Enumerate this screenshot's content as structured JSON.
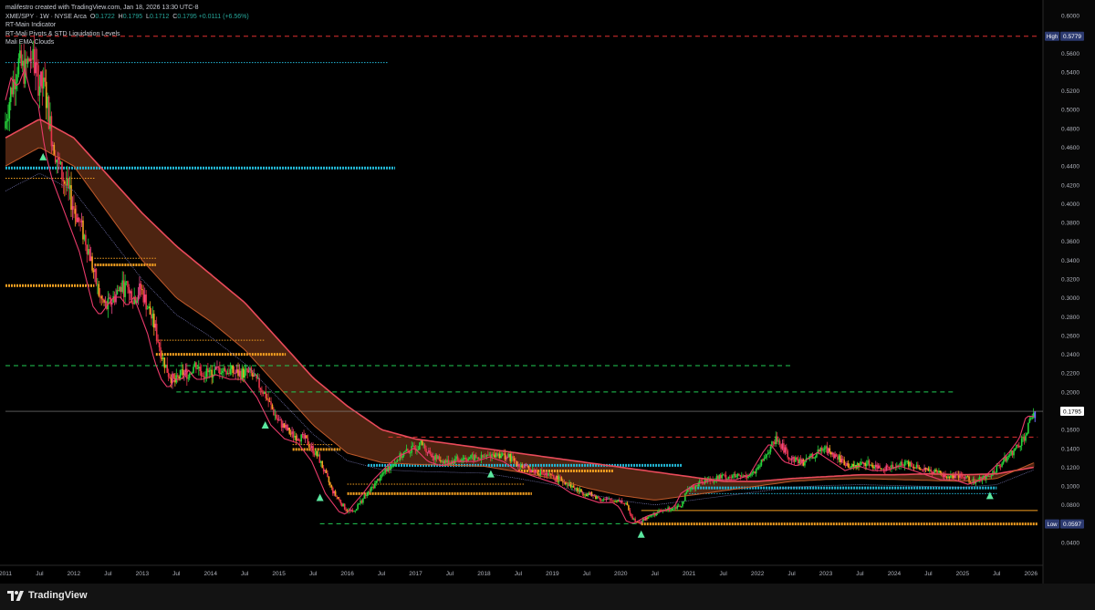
{
  "header": {
    "credit": "malifestro created with TradingView.com, Jan 18, 2026 13:30 UTC-8",
    "symbol": "XME/SPY · 1W · NYSE Arca",
    "ohlc": [
      {
        "k": "O",
        "v": "0.1722"
      },
      {
        "k": "H",
        "v": "0.1795"
      },
      {
        "k": "L",
        "v": "0.1712"
      },
      {
        "k": "C",
        "v": "0.1795"
      }
    ],
    "change": "+0.0111 (+6.56%)",
    "indicators": [
      "RT-Main Indicator",
      "RT-Mali Pivots & STD Liquidation Levels",
      "Mali EMA Clouds"
    ]
  },
  "footer": {
    "brand": "TradingView"
  },
  "colors": {
    "background": "#000000",
    "bull": "#26d43b",
    "bear": "#e8344a",
    "cloud_fill": "#5a2a14",
    "cloud_edge": "#e84a5a",
    "cyan_level": "#22b8d6",
    "orange_level": "#f5a020",
    "red_dash": "#e03030",
    "green_dash": "#22cc55"
  },
  "chart_data": {
    "type": "line",
    "x": [
      "2011",
      "Jul",
      "2012",
      "Jul",
      "2013",
      "Jul",
      "2014",
      "Jul",
      "2015",
      "Jul",
      "2016",
      "Jul",
      "2017",
      "Jul",
      "2018",
      "Jul",
      "2019",
      "Jul",
      "2020",
      "Jul",
      "2021",
      "Jul",
      "2022",
      "Jul",
      "2023",
      "Jul",
      "2024",
      "Jul",
      "2025",
      "Jul",
      "2026"
    ],
    "ylim": [
      0.02,
      0.6
    ],
    "y_ticks": [
      "0.6000",
      "0.5800",
      "0.5600",
      "0.5400",
      "0.5200",
      "0.5000",
      "0.4800",
      "0.4600",
      "0.4400",
      "0.4200",
      "0.4000",
      "0.3800",
      "0.3600",
      "0.3400",
      "0.3200",
      "0.3000",
      "0.2800",
      "0.2600",
      "0.2400",
      "0.2200",
      "0.2000",
      "0.1800",
      "0.1600",
      "0.1400",
      "0.1200",
      "0.1000",
      "0.0800",
      "0.0600",
      "0.0400"
    ],
    "price_label": "0.1795",
    "high": {
      "label": "High",
      "value": "0.5779"
    },
    "low": {
      "label": "Low",
      "value": "0.0597"
    },
    "series": [
      {
        "points": [
          [
            2011.0,
            0.48
          ],
          [
            2011.1,
            0.52
          ],
          [
            2011.2,
            0.55
          ],
          [
            2011.3,
            0.54
          ],
          [
            2011.4,
            0.56
          ],
          [
            2011.5,
            0.53
          ],
          [
            2011.6,
            0.52
          ],
          [
            2011.7,
            0.47
          ],
          [
            2011.8,
            0.44
          ],
          [
            2011.9,
            0.42
          ],
          [
            2012.0,
            0.4
          ],
          [
            2012.1,
            0.38
          ],
          [
            2012.2,
            0.36
          ],
          [
            2012.3,
            0.33
          ],
          [
            2012.4,
            0.3
          ],
          [
            2012.5,
            0.29
          ],
          [
            2012.6,
            0.3
          ],
          [
            2012.7,
            0.31
          ],
          [
            2012.8,
            0.31
          ],
          [
            2012.9,
            0.3
          ],
          [
            2013.0,
            0.31
          ],
          [
            2013.1,
            0.29
          ],
          [
            2013.2,
            0.27
          ],
          [
            2013.3,
            0.24
          ],
          [
            2013.4,
            0.22
          ],
          [
            2013.5,
            0.21
          ],
          [
            2013.6,
            0.22
          ],
          [
            2013.7,
            0.22
          ],
          [
            2013.8,
            0.23
          ],
          [
            2013.9,
            0.22
          ],
          [
            2014.0,
            0.22
          ],
          [
            2014.2,
            0.225
          ],
          [
            2014.4,
            0.22
          ],
          [
            2014.6,
            0.22
          ],
          [
            2014.8,
            0.2
          ],
          [
            2015.0,
            0.17
          ],
          [
            2015.2,
            0.155
          ],
          [
            2015.4,
            0.15
          ],
          [
            2015.6,
            0.13
          ],
          [
            2015.8,
            0.095
          ],
          [
            2016.0,
            0.075
          ],
          [
            2016.1,
            0.072
          ],
          [
            2016.2,
            0.082
          ],
          [
            2016.35,
            0.095
          ],
          [
            2016.5,
            0.11
          ],
          [
            2016.7,
            0.125
          ],
          [
            2016.85,
            0.135
          ],
          [
            2017.0,
            0.14
          ],
          [
            2017.1,
            0.145
          ],
          [
            2017.3,
            0.13
          ],
          [
            2017.5,
            0.125
          ],
          [
            2017.7,
            0.13
          ],
          [
            2017.9,
            0.13
          ],
          [
            2018.0,
            0.13
          ],
          [
            2018.2,
            0.135
          ],
          [
            2018.4,
            0.13
          ],
          [
            2018.6,
            0.12
          ],
          [
            2018.8,
            0.115
          ],
          [
            2019.0,
            0.11
          ],
          [
            2019.2,
            0.105
          ],
          [
            2019.4,
            0.095
          ],
          [
            2019.6,
            0.09
          ],
          [
            2019.8,
            0.085
          ],
          [
            2020.0,
            0.085
          ],
          [
            2020.1,
            0.08
          ],
          [
            2020.2,
            0.065
          ],
          [
            2020.3,
            0.062
          ],
          [
            2020.5,
            0.07
          ],
          [
            2020.7,
            0.075
          ],
          [
            2020.9,
            0.08
          ],
          [
            2021.0,
            0.095
          ],
          [
            2021.2,
            0.105
          ],
          [
            2021.5,
            0.11
          ],
          [
            2021.8,
            0.11
          ],
          [
            2022.0,
            0.115
          ],
          [
            2022.2,
            0.14
          ],
          [
            2022.3,
            0.15
          ],
          [
            2022.5,
            0.13
          ],
          [
            2022.7,
            0.125
          ],
          [
            2022.9,
            0.135
          ],
          [
            2023.0,
            0.14
          ],
          [
            2023.2,
            0.13
          ],
          [
            2023.4,
            0.12
          ],
          [
            2023.6,
            0.125
          ],
          [
            2023.8,
            0.12
          ],
          [
            2024.0,
            0.12
          ],
          [
            2024.2,
            0.125
          ],
          [
            2024.4,
            0.12
          ],
          [
            2024.6,
            0.115
          ],
          [
            2024.8,
            0.11
          ],
          [
            2025.0,
            0.11
          ],
          [
            2025.2,
            0.105
          ],
          [
            2025.4,
            0.11
          ],
          [
            2025.6,
            0.125
          ],
          [
            2025.8,
            0.14
          ],
          [
            2025.95,
            0.155
          ],
          [
            2026.05,
            0.1795
          ]
        ]
      },
      {
        "points": [
          [
            2011.0,
            0.47
          ],
          [
            2011.5,
            0.49
          ],
          [
            2012.0,
            0.47
          ],
          [
            2012.5,
            0.43
          ],
          [
            2013.0,
            0.39
          ],
          [
            2013.5,
            0.355
          ],
          [
            2014.0,
            0.325
          ],
          [
            2014.5,
            0.295
          ],
          [
            2015.0,
            0.255
          ],
          [
            2015.5,
            0.215
          ],
          [
            2016.0,
            0.185
          ],
          [
            2016.5,
            0.16
          ],
          [
            2017.0,
            0.15
          ],
          [
            2017.5,
            0.145
          ],
          [
            2018.0,
            0.14
          ],
          [
            2018.5,
            0.135
          ],
          [
            2019.0,
            0.13
          ],
          [
            2019.5,
            0.125
          ],
          [
            2020.0,
            0.12
          ],
          [
            2020.5,
            0.115
          ],
          [
            2021.0,
            0.11
          ],
          [
            2021.5,
            0.105
          ],
          [
            2022.0,
            0.105
          ],
          [
            2022.5,
            0.108
          ],
          [
            2023.0,
            0.11
          ],
          [
            2023.5,
            0.112
          ],
          [
            2024.0,
            0.112
          ],
          [
            2024.5,
            0.113
          ],
          [
            2025.0,
            0.112
          ],
          [
            2025.5,
            0.113
          ],
          [
            2026.05,
            0.12
          ]
        ]
      },
      {
        "points": [
          [
            2011.0,
            0.44
          ],
          [
            2011.5,
            0.46
          ],
          [
            2012.0,
            0.44
          ],
          [
            2012.5,
            0.39
          ],
          [
            2013.0,
            0.34
          ],
          [
            2013.5,
            0.3
          ],
          [
            2014.0,
            0.275
          ],
          [
            2014.5,
            0.245
          ],
          [
            2015.0,
            0.205
          ],
          [
            2015.5,
            0.165
          ],
          [
            2016.0,
            0.135
          ],
          [
            2016.5,
            0.125
          ],
          [
            2017.0,
            0.123
          ],
          [
            2017.5,
            0.122
          ],
          [
            2018.0,
            0.121
          ],
          [
            2018.5,
            0.115
          ],
          [
            2019.0,
            0.108
          ],
          [
            2019.5,
            0.098
          ],
          [
            2020.0,
            0.09
          ],
          [
            2020.5,
            0.085
          ],
          [
            2021.0,
            0.09
          ],
          [
            2021.5,
            0.095
          ],
          [
            2022.0,
            0.1
          ],
          [
            2022.5,
            0.105
          ],
          [
            2023.0,
            0.107
          ],
          [
            2023.5,
            0.108
          ],
          [
            2024.0,
            0.107
          ],
          [
            2024.5,
            0.106
          ],
          [
            2025.0,
            0.105
          ],
          [
            2025.5,
            0.108
          ],
          [
            2026.05,
            0.125
          ]
        ]
      }
    ],
    "levels": [
      {
        "value": 0.5779,
        "style": "dashed",
        "color": "#e03030",
        "from": 2011.0,
        "to": 2026.1
      },
      {
        "value": 0.55,
        "style": "dotted",
        "color": "#22b8d6",
        "from": 2011.0,
        "to": 2016.6
      },
      {
        "value": 0.438,
        "style": "thick",
        "color": "#22b8d6",
        "from": 2011.0,
        "to": 2016.7
      },
      {
        "value": 0.427,
        "style": "dotted",
        "color": "#f5a020",
        "from": 2011.0,
        "to": 2012.3
      },
      {
        "value": 0.342,
        "style": "dotted",
        "color": "#f5a020",
        "from": 2012.3,
        "to": 2013.2
      },
      {
        "value": 0.335,
        "style": "thick",
        "color": "#f5a020",
        "from": 2012.3,
        "to": 2013.2
      },
      {
        "value": 0.313,
        "style": "thick",
        "color": "#f5a020",
        "from": 2011.0,
        "to": 2012.3
      },
      {
        "value": 0.255,
        "style": "dotted",
        "color": "#f5a020",
        "from": 2013.2,
        "to": 2014.8
      },
      {
        "value": 0.24,
        "style": "thick",
        "color": "#f5a020",
        "from": 2013.2,
        "to": 2015.1
      },
      {
        "value": 0.228,
        "style": "dashed",
        "color": "#22cc55",
        "from": 2011.0,
        "to": 2022.5
      },
      {
        "value": 0.2,
        "style": "dashed",
        "color": "#22cc55",
        "from": 2013.5,
        "to": 2024.9
      },
      {
        "value": 0.152,
        "style": "dashed",
        "color": "#e03030",
        "from": 2016.6,
        "to": 2026.1
      },
      {
        "value": 0.144,
        "style": "dotted",
        "color": "#f5a020",
        "from": 2015.2,
        "to": 2015.8
      },
      {
        "value": 0.139,
        "style": "thick",
        "color": "#f5a020",
        "from": 2015.2,
        "to": 2015.9
      },
      {
        "value": 0.122,
        "style": "thick",
        "color": "#22b8d6",
        "from": 2016.3,
        "to": 2020.9
      },
      {
        "value": 0.116,
        "style": "thick",
        "color": "#f5a020",
        "from": 2018.5,
        "to": 2019.9
      },
      {
        "value": 0.102,
        "style": "dotted",
        "color": "#f5a020",
        "from": 2016.0,
        "to": 2018.6
      },
      {
        "value": 0.098,
        "style": "thick",
        "color": "#22b8d6",
        "from": 2021.0,
        "to": 2025.5
      },
      {
        "value": 0.092,
        "style": "thick",
        "color": "#f5a020",
        "from": 2016.0,
        "to": 2018.7
      },
      {
        "value": 0.092,
        "style": "dotted",
        "color": "#22b8d6",
        "from": 2021.0,
        "to": 2025.5
      },
      {
        "value": 0.074,
        "style": "solid",
        "color": "#f5a020",
        "from": 2020.3,
        "to": 2026.1
      },
      {
        "value": 0.06,
        "style": "dashed",
        "color": "#22cc55",
        "from": 2015.6,
        "to": 2020.3
      },
      {
        "value": 0.0597,
        "style": "thick",
        "color": "#f5a020",
        "from": 2020.3,
        "to": 2026.1
      }
    ],
    "triangles": [
      [
        2011.55,
        0.45
      ],
      [
        2014.8,
        0.165
      ],
      [
        2015.6,
        0.088
      ],
      [
        2018.1,
        0.113
      ],
      [
        2020.3,
        0.049
      ],
      [
        2025.4,
        0.09
      ]
    ],
    "grid": false
  }
}
